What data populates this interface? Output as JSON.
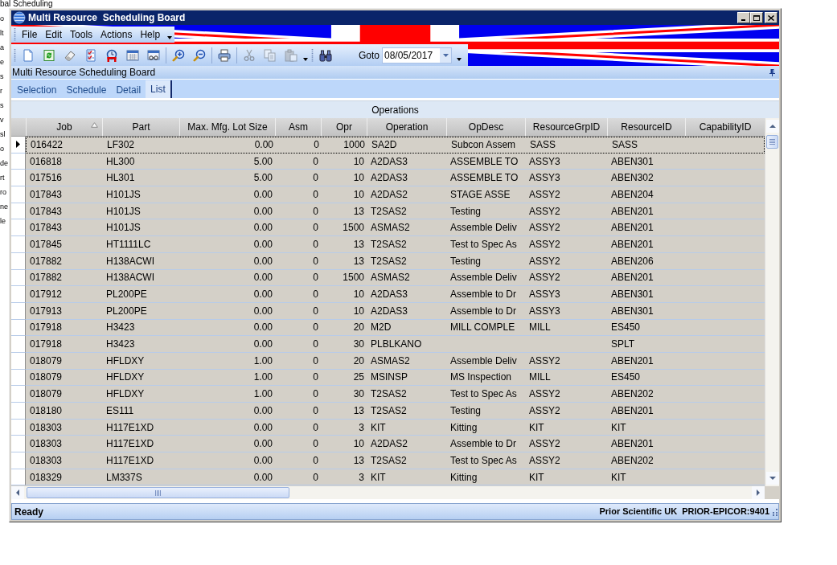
{
  "background_window": {
    "title": "bal Scheduling",
    "edge_texts": [
      "o",
      "lt",
      "a",
      "e",
      "s",
      "r",
      "s",
      "v",
      "sl",
      "o",
      "de",
      "rt",
      "ro",
      "ne",
      "le"
    ]
  },
  "window": {
    "title": "Multi Resource  Scheduling Board"
  },
  "menu": [
    "File",
    "Edit",
    "Tools",
    "Actions",
    "Help"
  ],
  "toolbar": {
    "buttons": [
      {
        "disabled": false
      },
      {
        "disabled": false
      },
      {
        "disabled": false
      },
      {
        "disabled": false
      },
      {
        "disabled": false
      },
      {
        "disabled": false
      },
      {
        "disabled": false
      },
      {
        "disabled": false
      },
      {
        "disabled": false
      },
      {
        "disabled": false
      },
      {
        "disabled": true
      },
      {
        "disabled": true
      },
      {
        "disabled": true
      },
      {
        "disabled": false
      }
    ],
    "goto_label": "Goto",
    "goto_date": "08/05/2017"
  },
  "panel": {
    "title": "Multi Resource Scheduling Board"
  },
  "tabs": [
    {
      "label": "Selection",
      "selected": false
    },
    {
      "label": "Schedule",
      "selected": false
    },
    {
      "label": "Detail",
      "selected": false
    },
    {
      "label": "List",
      "selected": true
    }
  ],
  "grid": {
    "caption": "Operations",
    "columns": [
      {
        "label": "Job",
        "kind": "text",
        "sorted": true
      },
      {
        "label": "Part",
        "kind": "text",
        "sorted": false
      },
      {
        "label": "Max. Mfg. Lot Size",
        "kind": "number",
        "sorted": false
      },
      {
        "label": "Asm",
        "kind": "number",
        "sorted": false
      },
      {
        "label": "Opr",
        "kind": "number",
        "sorted": false
      },
      {
        "label": "Operation",
        "kind": "text",
        "sorted": false
      },
      {
        "label": "OpDesc",
        "kind": "text",
        "sorted": false
      },
      {
        "label": "ResourceGrpID",
        "kind": "text",
        "sorted": false
      },
      {
        "label": "ResourceID",
        "kind": "text",
        "sorted": false
      },
      {
        "label": "CapabilityID",
        "kind": "text",
        "sorted": false
      }
    ],
    "rows": [
      {
        "selected": true,
        "cells": [
          "016422",
          "LF302",
          "0.00",
          "0",
          "1000",
          "SA2D",
          "Subcon Assem",
          "SASS",
          "SASS"
        ]
      },
      {
        "selected": false,
        "cells": [
          "016818",
          "HL300",
          "5.00",
          "0",
          "10",
          "A2DAS3",
          "ASSEMBLE TO",
          "ASSY3",
          "ABEN301"
        ]
      },
      {
        "selected": false,
        "cells": [
          "017516",
          "HL301",
          "5.00",
          "0",
          "10",
          "A2DAS3",
          "ASSEMBLE TO",
          "ASSY3",
          "ABEN302"
        ]
      },
      {
        "selected": false,
        "cells": [
          "017843",
          "H101JS",
          "0.00",
          "0",
          "10",
          "A2DAS2",
          "STAGE ASSE",
          "ASSY2",
          "ABEN204"
        ]
      },
      {
        "selected": false,
        "cells": [
          "017843",
          "H101JS",
          "0.00",
          "0",
          "13",
          "T2SAS2",
          "Testing",
          "ASSY2",
          "ABEN201"
        ]
      },
      {
        "selected": false,
        "cells": [
          "017843",
          "H101JS",
          "0.00",
          "0",
          "1500",
          "ASMAS2",
          "Assemble Deliv",
          "ASSY2",
          "ABEN201"
        ]
      },
      {
        "selected": false,
        "cells": [
          "017845",
          "HT1111LC",
          "0.00",
          "0",
          "13",
          "T2SAS2",
          "Test to Spec As",
          "ASSY2",
          "ABEN201"
        ]
      },
      {
        "selected": false,
        "cells": [
          "017882",
          "H138ACWI",
          "0.00",
          "0",
          "13",
          "T2SAS2",
          "Testing",
          "ASSY2",
          "ABEN206"
        ]
      },
      {
        "selected": false,
        "cells": [
          "017882",
          "H138ACWI",
          "0.00",
          "0",
          "1500",
          "ASMAS2",
          "Assemble Deliv",
          "ASSY2",
          "ABEN201"
        ]
      },
      {
        "selected": false,
        "cells": [
          "017912",
          "PL200PE",
          "0.00",
          "0",
          "10",
          "A2DAS3",
          "Assemble to Dr",
          "ASSY3",
          "ABEN301"
        ]
      },
      {
        "selected": false,
        "cells": [
          "017913",
          "PL200PE",
          "0.00",
          "0",
          "10",
          "A2DAS3",
          "Assemble to Dr",
          "ASSY3",
          "ABEN301"
        ]
      },
      {
        "selected": false,
        "cells": [
          "017918",
          "H3423",
          "0.00",
          "0",
          "20",
          "M2D",
          "MILL COMPLE",
          "MILL",
          "ES450"
        ]
      },
      {
        "selected": false,
        "cells": [
          "017918",
          "H3423",
          "0.00",
          "0",
          "30",
          "PLBLKANO",
          null,
          null,
          "SPLT"
        ]
      },
      {
        "selected": false,
        "cells": [
          "018079",
          "HFLDXY",
          "1.00",
          "0",
          "20",
          "ASMAS2",
          "Assemble Deliv",
          "ASSY2",
          "ABEN201"
        ]
      },
      {
        "selected": false,
        "cells": [
          "018079",
          "HFLDXY",
          "1.00",
          "0",
          "25",
          "MSINSP",
          "MS Inspection",
          "MILL",
          "ES450"
        ]
      },
      {
        "selected": false,
        "cells": [
          "018079",
          "HFLDXY",
          "1.00",
          "0",
          "30",
          "T2SAS2",
          "Test to Spec As",
          "ASSY2",
          "ABEN202"
        ]
      },
      {
        "selected": false,
        "cells": [
          "018180",
          "ES111",
          "0.00",
          "0",
          "13",
          "T2SAS2",
          "Testing",
          "ASSY2",
          "ABEN201"
        ]
      },
      {
        "selected": false,
        "cells": [
          "018303",
          "H117E1XD",
          "0.00",
          "0",
          "3",
          "KIT",
          "Kitting",
          "KIT",
          "KIT"
        ]
      },
      {
        "selected": false,
        "cells": [
          "018303",
          "H117E1XD",
          "0.00",
          "0",
          "10",
          "A2DAS2",
          "Assemble to Dr",
          "ASSY2",
          "ABEN201"
        ]
      },
      {
        "selected": false,
        "cells": [
          "018303",
          "H117E1XD",
          "0.00",
          "0",
          "13",
          "T2SAS2",
          "Test to Spec As",
          "ASSY2",
          "ABEN202"
        ]
      },
      {
        "selected": false,
        "cells": [
          "018329",
          "LM337S",
          "0.00",
          "0",
          "3",
          "KIT",
          "Kitting",
          "KIT",
          "KIT"
        ]
      }
    ]
  },
  "status_bar": {
    "left": "Ready",
    "right": "Prior Scientific UK  PRIOR-EPICOR:9401"
  }
}
